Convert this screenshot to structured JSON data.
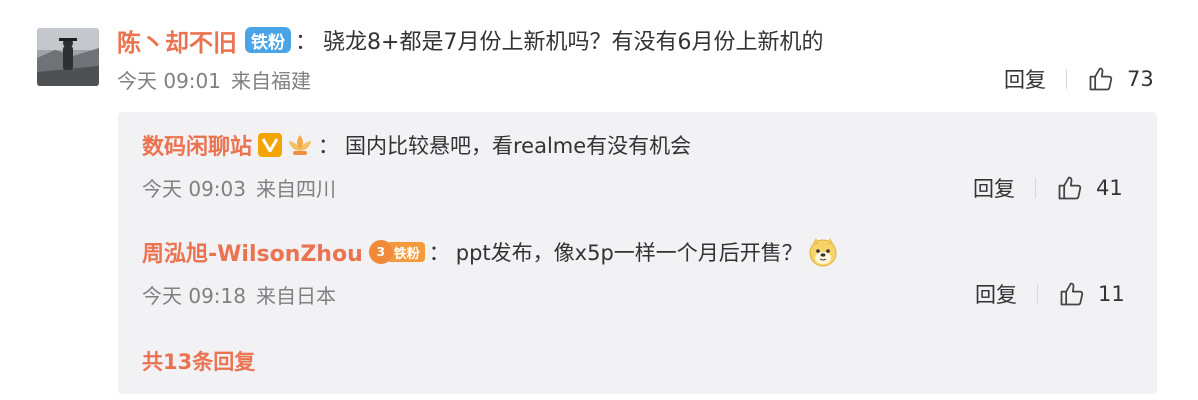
{
  "main_comment": {
    "username": "陈丶却不旧",
    "fan_badge": "铁粉",
    "colon": "：",
    "text": "骁龙8+都是7月份上新机吗？有没有6月份上新机的",
    "time": "今天 09:01",
    "location": "来自福建",
    "reply_label": "回复",
    "likes": "73",
    "icons": {
      "avatar": "avatar",
      "like": "thumbs-up-icon"
    }
  },
  "replies": [
    {
      "username": "数码闲聊站",
      "colon": "：",
      "text": "国内比较悬吧，看realme有没有机会",
      "time": "今天 09:03",
      "location": "来自四川",
      "reply_label": "回复",
      "likes": "41",
      "icons": {
        "verified": "verified-v-icon",
        "badge": "lotus-badge-icon"
      }
    },
    {
      "username": "周泓旭-WilsonZhou",
      "fan_badge": "铁粉",
      "crown_char": "3",
      "colon": "：",
      "text": "ppt发布，像x5p一样一个月后开售？",
      "time": "今天 09:18",
      "location": "来自日本",
      "reply_label": "回复",
      "likes": "11",
      "icons": {
        "badge": "crown-fan-badge-icon",
        "emoji": "doge-emoji-icon"
      }
    }
  ],
  "more_replies": "共13条回复",
  "colors": {
    "username": "#eb7350",
    "fan_badge_blue": "#4ba4e8",
    "meta_gray": "#808080",
    "reply_bg": "#f2f2f5"
  }
}
